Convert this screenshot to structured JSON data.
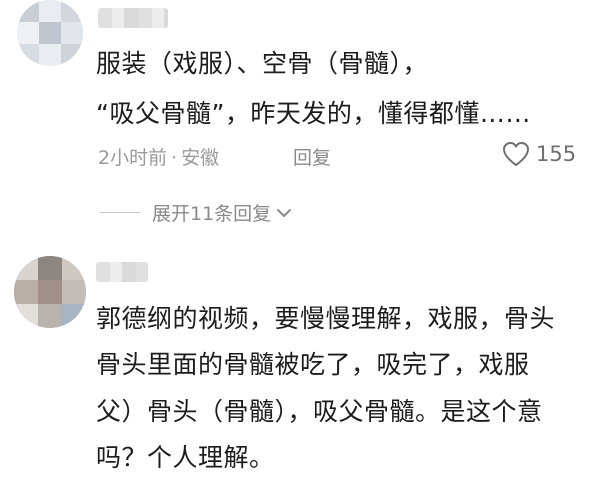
{
  "comments": [
    {
      "body_lines": [
        "服装（戏服）、空骨（骨髓），",
        "“吸父骨髓”，昨天发的，懂得都懂……"
      ],
      "time": "2小时前",
      "separator": "·",
      "location": "安徽",
      "reply_label": "回复",
      "likes": "155",
      "expand_label": "展开11条回复"
    },
    {
      "body_lines": [
        "郭德纲的视频，要慢慢理解，戏服，骨头",
        "骨头里面的骨髓被吃了，吸完了，戏服",
        "父）骨头（骨髓），吸父骨髓。是这个意",
        "吗？个人理解。"
      ]
    }
  ],
  "icons": {
    "like": "heart-outline-icon",
    "expand": "chevron-down-icon"
  }
}
